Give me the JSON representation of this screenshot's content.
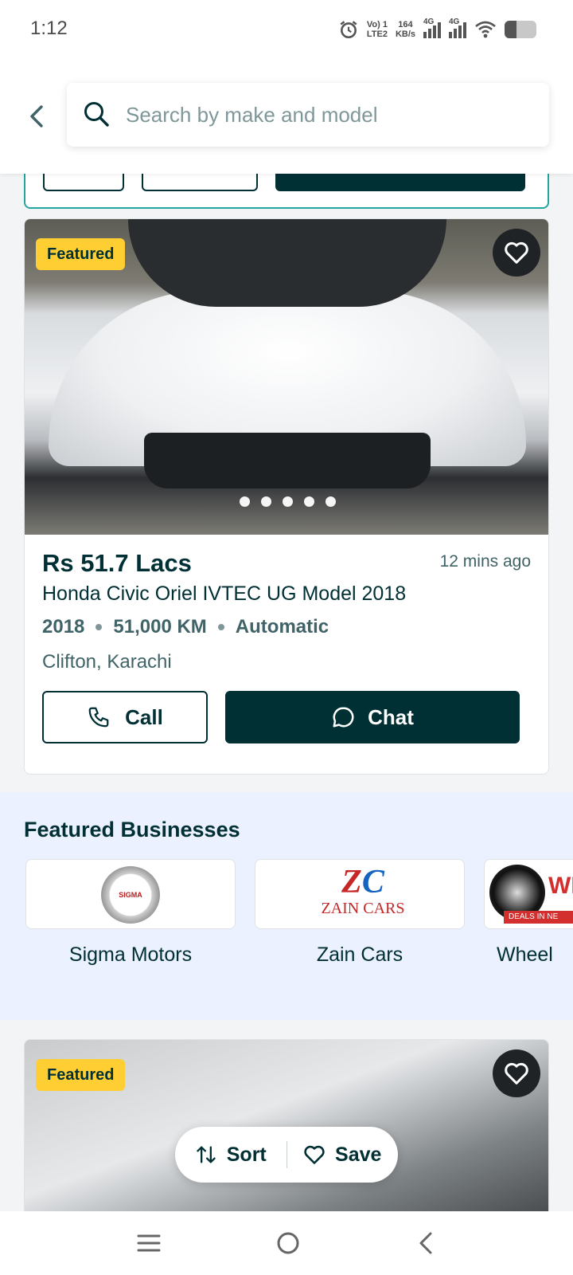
{
  "status_bar": {
    "time": "1:12",
    "volte": "Vo) 1",
    "lte": "LTE2",
    "speed_value": "164",
    "speed_unit": "KB/s",
    "net1": "4G",
    "net2": "4G",
    "battery_level": 0.35
  },
  "header": {
    "search_placeholder": "Search by make and model"
  },
  "listing1": {
    "badge": "Featured",
    "price": "Rs 51.7 Lacs",
    "posted": "12 mins ago",
    "title": "Honda Civic Oriel IVTEC UG Model 2018",
    "year": "2018",
    "mileage": "51,000 KM",
    "transmission": "Automatic",
    "location": "Clifton, Karachi",
    "call_label": "Call",
    "chat_label": "Chat",
    "photo_count": 5,
    "photo_index": 1
  },
  "featured_businesses": {
    "title": "Featured Businesses",
    "items": [
      {
        "name": "Sigma Motors",
        "logo_text": "SIGMA"
      },
      {
        "name": "Zain Cars",
        "logo_text": "ZAIN CARS"
      },
      {
        "name": "Wheel",
        "logo_text": "WH",
        "logo_subtext": "DEALS IN NE"
      }
    ]
  },
  "listing2": {
    "badge": "Featured"
  },
  "floating_actions": {
    "sort_label": "Sort",
    "save_label": "Save"
  },
  "colors": {
    "primary": "#002f34",
    "accent_teal": "#23a5a0",
    "badge_yellow": "#ffce32",
    "section_bg": "#ebf1fe"
  }
}
